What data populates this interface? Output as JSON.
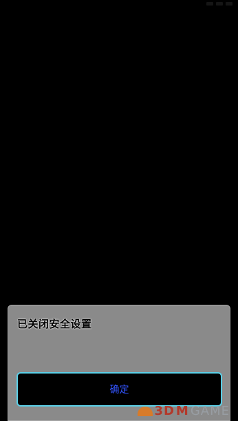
{
  "status_bar": {
    "time": "",
    "icons": [
      "signal-icon",
      "wifi-icon",
      "battery-icon"
    ]
  },
  "dialog": {
    "message": "已关闭安全设置",
    "confirm_label": "确定"
  },
  "watermark": {
    "brand": "3D",
    "brand_suffix": "M",
    "game_text": "GAME"
  },
  "colors": {
    "background": "#000000",
    "dialog_bg": "#8a8a8a",
    "button_bg": "#000000",
    "button_border": "#5ad0e8",
    "button_text": "#3355ff"
  }
}
